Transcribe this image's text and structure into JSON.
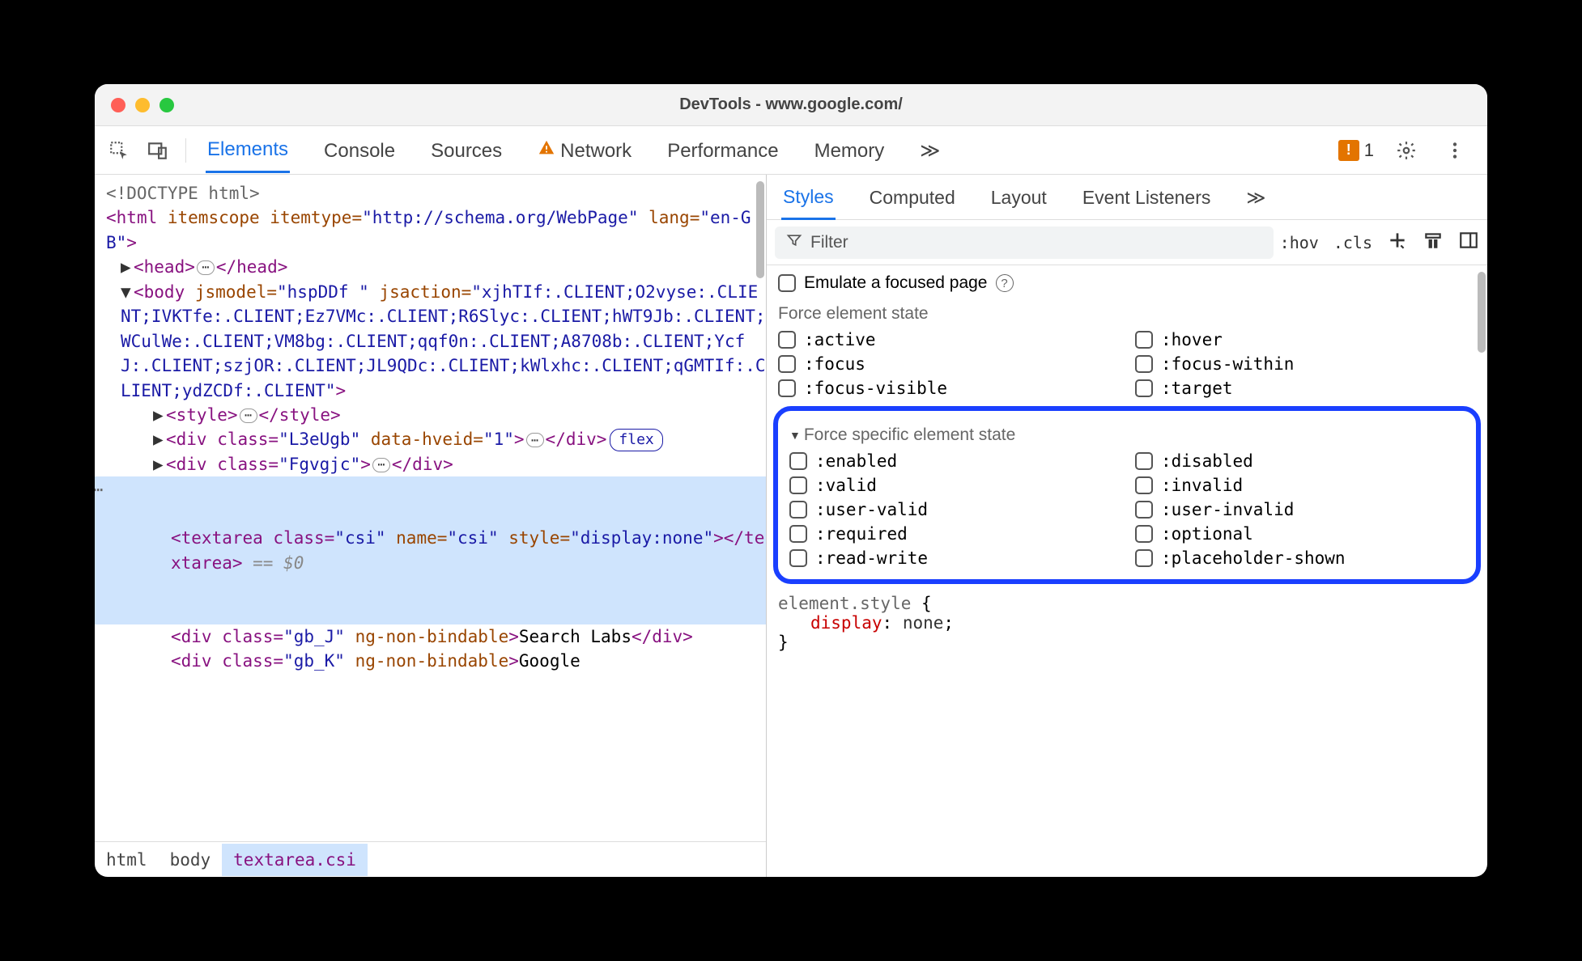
{
  "window": {
    "title": "DevTools - www.google.com/"
  },
  "toolbar": {
    "tabs": [
      {
        "label": "Elements",
        "active": true
      },
      {
        "label": "Console"
      },
      {
        "label": "Sources"
      },
      {
        "label": "Network",
        "warn": true
      },
      {
        "label": "Performance"
      },
      {
        "label": "Memory"
      }
    ],
    "more": "≫",
    "issue_count": "1"
  },
  "dom": {
    "doctype": "<!DOCTYPE html>",
    "html_open1": "<",
    "html_tag": "html",
    "html_attrs": " itemscope itemtype=",
    "html_val1": "\"http://schema.org/WebPage\"",
    "html_attrs2": " lang=",
    "html_val2": "\"en-GB\"",
    "html_close": ">",
    "head_open": "<head>",
    "head_close": "</head>",
    "body_open": "<body jsmodel=",
    "body_val1": "\"hspDDf \"",
    "body_attr2": " jsaction=",
    "body_val2": "\"xjhTIf:.CLIENT;O2vyse:.CLIENT;IVKTfe:.CLIENT;Ez7VMc:.CLIENT;R6Slyc:.CLIENT;hWT9Jb:.CLIENT;WCulWe:.CLIENT;VM8bg:.CLIENT;qqf0n:.CLIENT;A8708b:.CLIENT;YcfJ:.CLIENT;szjOR:.CLIENT;JL9QDc:.CLIENT;kWlxhc:.CLIENT;qGMTIf:.CLIENT;ydZCDf:.CLIENT\"",
    "body_close": ">",
    "style_open": "<style>",
    "style_close": "</style>",
    "div1_open": "<div class=",
    "div1_val": "\"L3eUgb\"",
    "div1_attr2": " data-hveid=",
    "div1_val2": "\"1\"",
    "div1_close": "></div>",
    "flex": "flex",
    "div2_open": "<div class=",
    "div2_val": "\"Fgvgjc\"",
    "div2_close": "></div>",
    "textarea_open": "<textarea class=",
    "textarea_val1": "\"csi\"",
    "textarea_attr2": " name=",
    "textarea_val2": "\"csi\"",
    "textarea_attr3": " style=",
    "textarea_val3": "\"display:none\"",
    "textarea_close": "></textarea>",
    "dollar0": " == $0",
    "div3_open": "<div class=",
    "div3_val": "\"gb_J\"",
    "div3_attr": " ng-non-bindable",
    "div3_text": "Search Labs",
    "div3_close": "</div>",
    "div4_open": "<div class=",
    "div4_val": "\"gb_K\"",
    "div4_attr": " ng-non-bindable",
    "div4_text": "Google"
  },
  "breadcrumb": [
    {
      "label": "html"
    },
    {
      "label": "body"
    },
    {
      "label": "textarea.csi",
      "active": true
    }
  ],
  "styles": {
    "tabs": [
      {
        "label": "Styles",
        "active": true
      },
      {
        "label": "Computed"
      },
      {
        "label": "Layout"
      },
      {
        "label": "Event Listeners"
      }
    ],
    "more": "≫",
    "filter_placeholder": "Filter",
    "hov": ":hov",
    "cls": ".cls",
    "emulate": "Emulate a focused page",
    "force_header": "Force element state",
    "force_states": [
      ":active",
      ":hover",
      ":focus",
      ":focus-within",
      ":focus-visible",
      ":target"
    ],
    "specific_header": "Force specific element state",
    "specific_states": [
      ":enabled",
      ":disabled",
      ":valid",
      ":invalid",
      ":user-valid",
      ":user-invalid",
      ":required",
      ":optional",
      ":read-write",
      ":placeholder-shown"
    ],
    "style_sel": "element.style",
    "style_brace_open": " {",
    "style_prop": "display",
    "style_colon": ": ",
    "style_val": "none",
    "style_semi": ";",
    "style_brace_close": "}"
  }
}
